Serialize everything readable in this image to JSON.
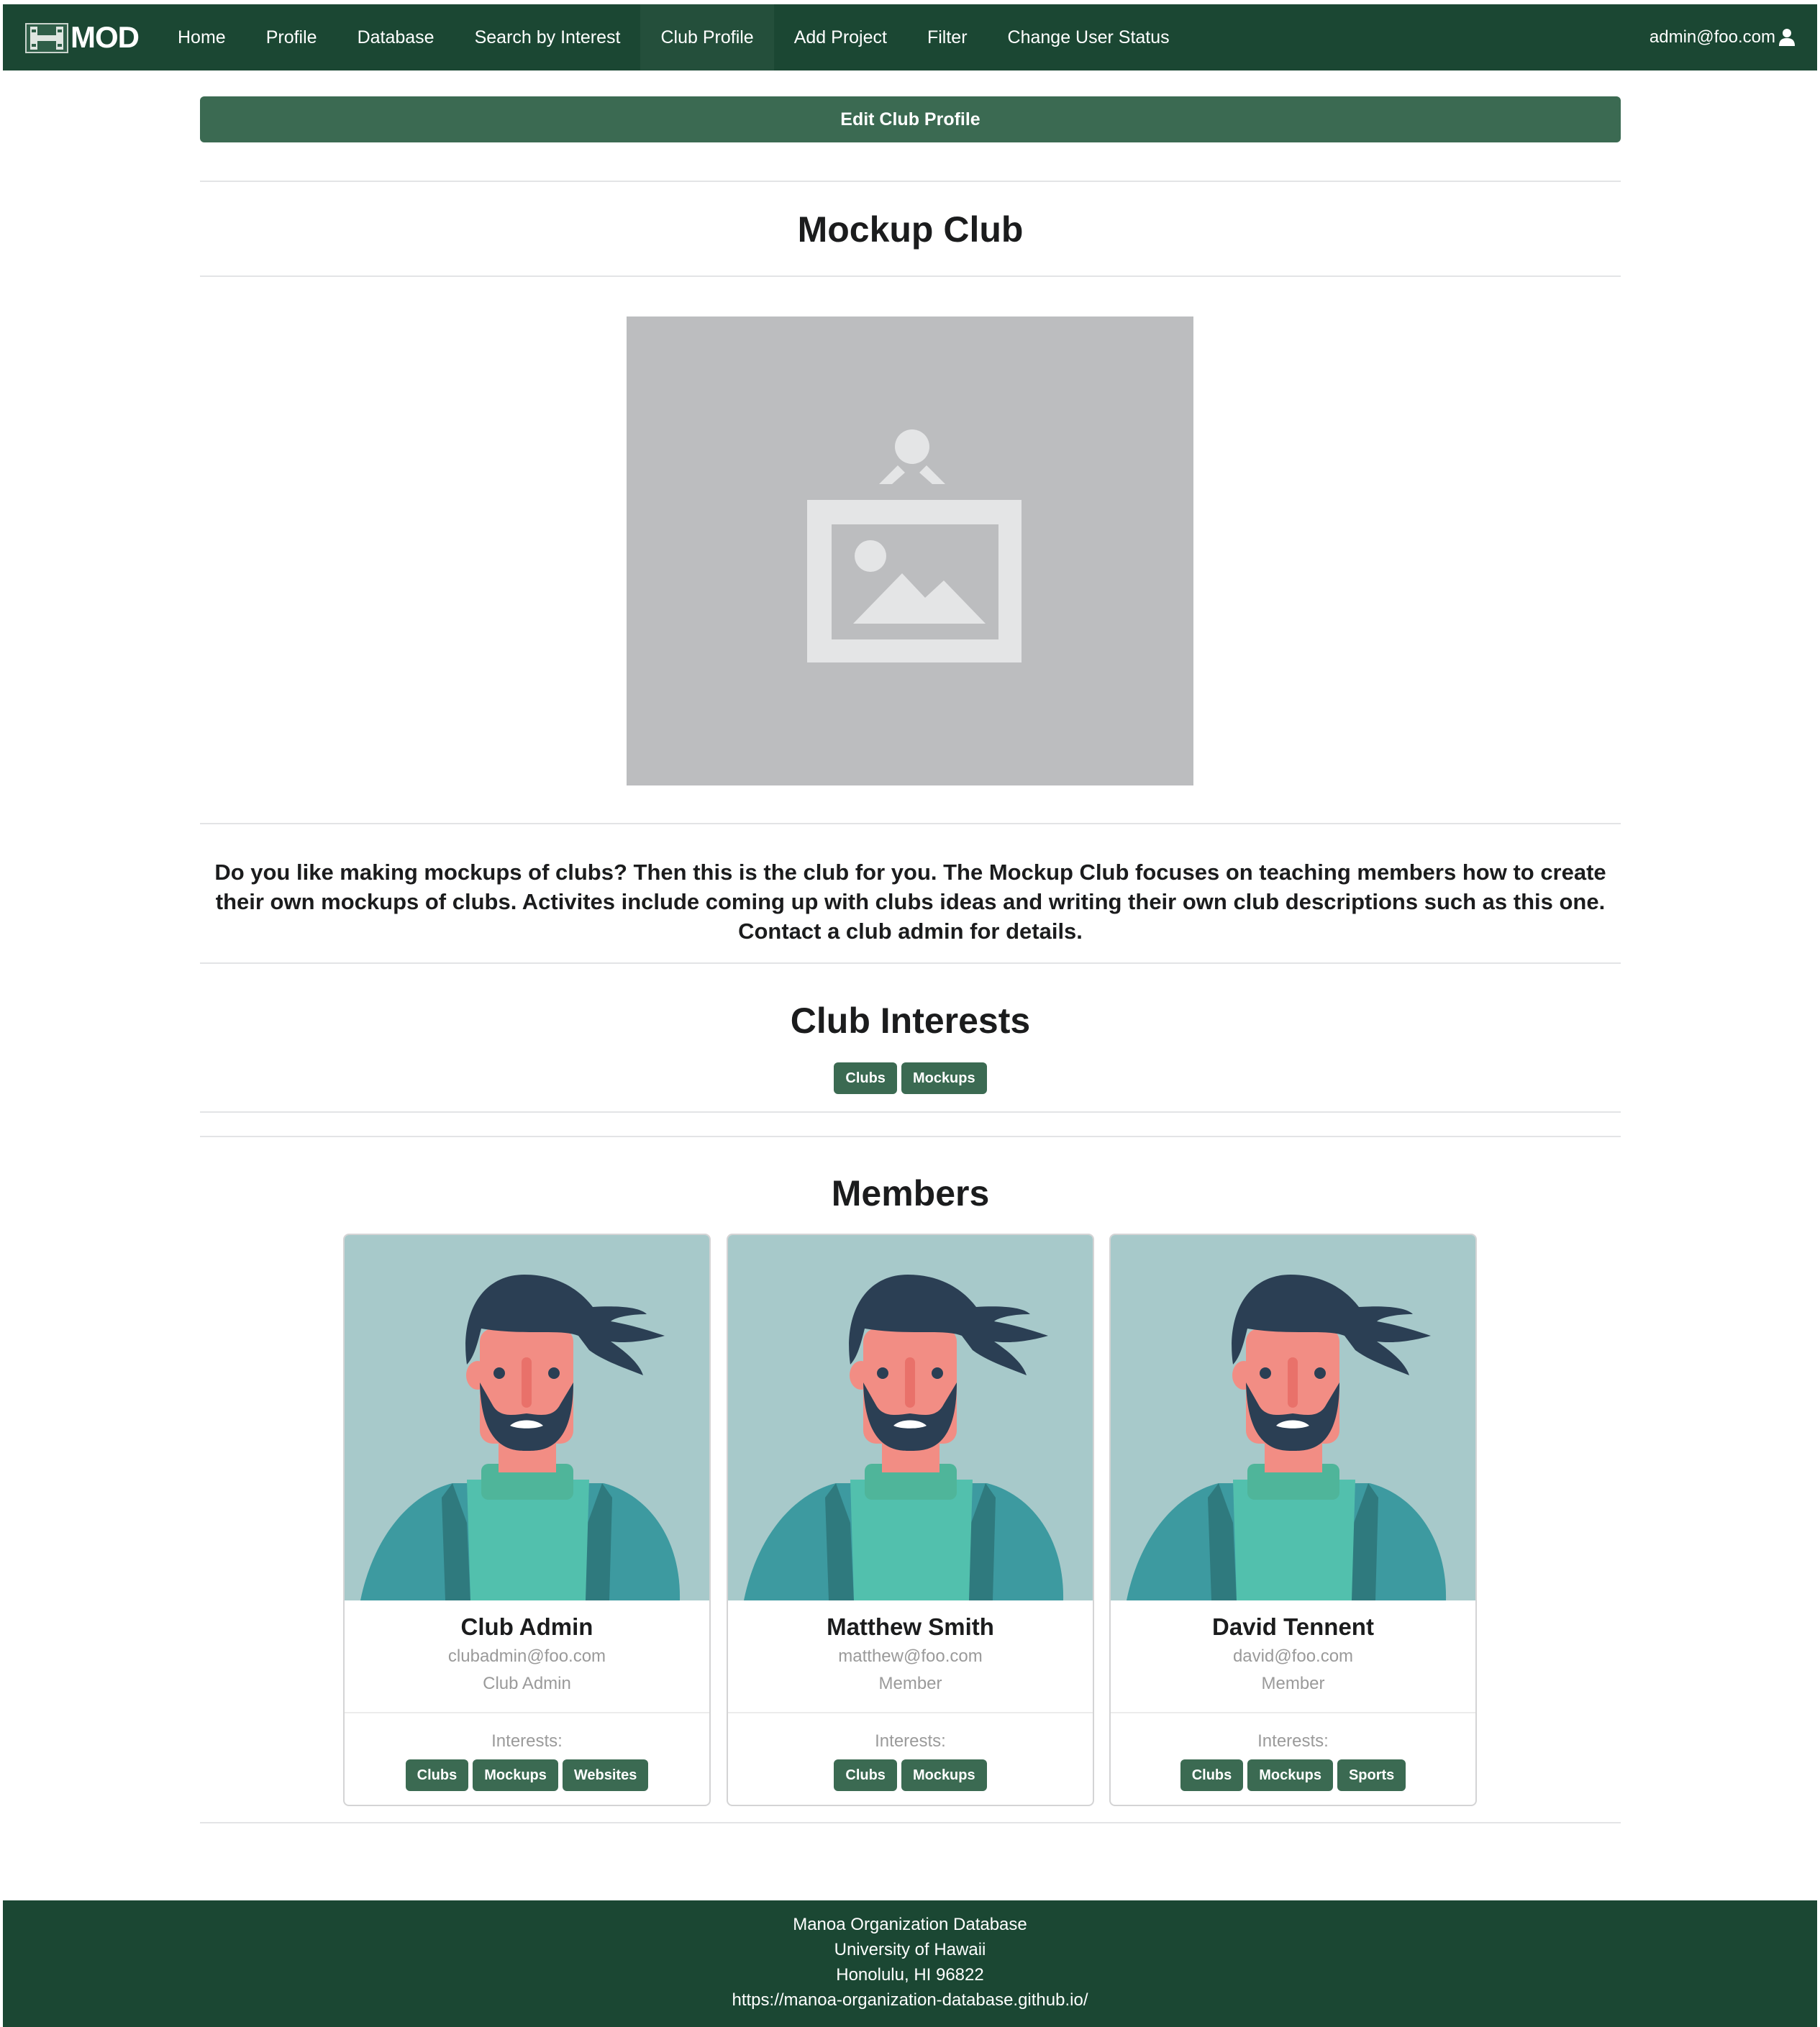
{
  "navbar": {
    "logo_text": "MOD",
    "items": [
      {
        "label": "Home"
      },
      {
        "label": "Profile"
      },
      {
        "label": "Database"
      },
      {
        "label": "Search by Interest"
      },
      {
        "label": "Club Profile",
        "active": true
      },
      {
        "label": "Add Project"
      },
      {
        "label": "Filter"
      },
      {
        "label": "Change User Status"
      }
    ],
    "user_email": "admin@foo.com",
    "user_icon": "user-icon"
  },
  "edit_button_label": "Edit Club Profile",
  "club": {
    "name": "Mockup Club",
    "image_icon": "image-placeholder-icon",
    "description": "Do you like making mockups of clubs? Then this is the club for you. The Mockup Club focuses on teaching members how to create their own mockups of clubs. Activites include coming up with clubs ideas and writing their own club descriptions such as this one. Contact a club admin for details."
  },
  "interests_section": {
    "title": "Club Interests",
    "tags": [
      "Clubs",
      "Mockups"
    ]
  },
  "members_section": {
    "title": "Members",
    "interests_label": "Interests:",
    "members": [
      {
        "name": "Club Admin",
        "email": "clubadmin@foo.com",
        "role": "Club Admin",
        "interests": [
          "Clubs",
          "Mockups",
          "Websites"
        ]
      },
      {
        "name": "Matthew Smith",
        "email": "matthew@foo.com",
        "role": "Member",
        "interests": [
          "Clubs",
          "Mockups"
        ]
      },
      {
        "name": "David Tennent",
        "email": "david@foo.com",
        "role": "Member",
        "interests": [
          "Clubs",
          "Mockups",
          "Sports"
        ]
      }
    ]
  },
  "footer": {
    "line1": "Manoa Organization Database",
    "line2": "University of Hawaii",
    "line3": "Honolulu, HI 96822",
    "line4": "https://manoa-organization-database.github.io/"
  },
  "colors": {
    "nav_bg": "#1b4733",
    "accent": "#3b6a52",
    "avatar_bg": "#a7c9ca",
    "placeholder_bg": "#bcbdbf"
  }
}
